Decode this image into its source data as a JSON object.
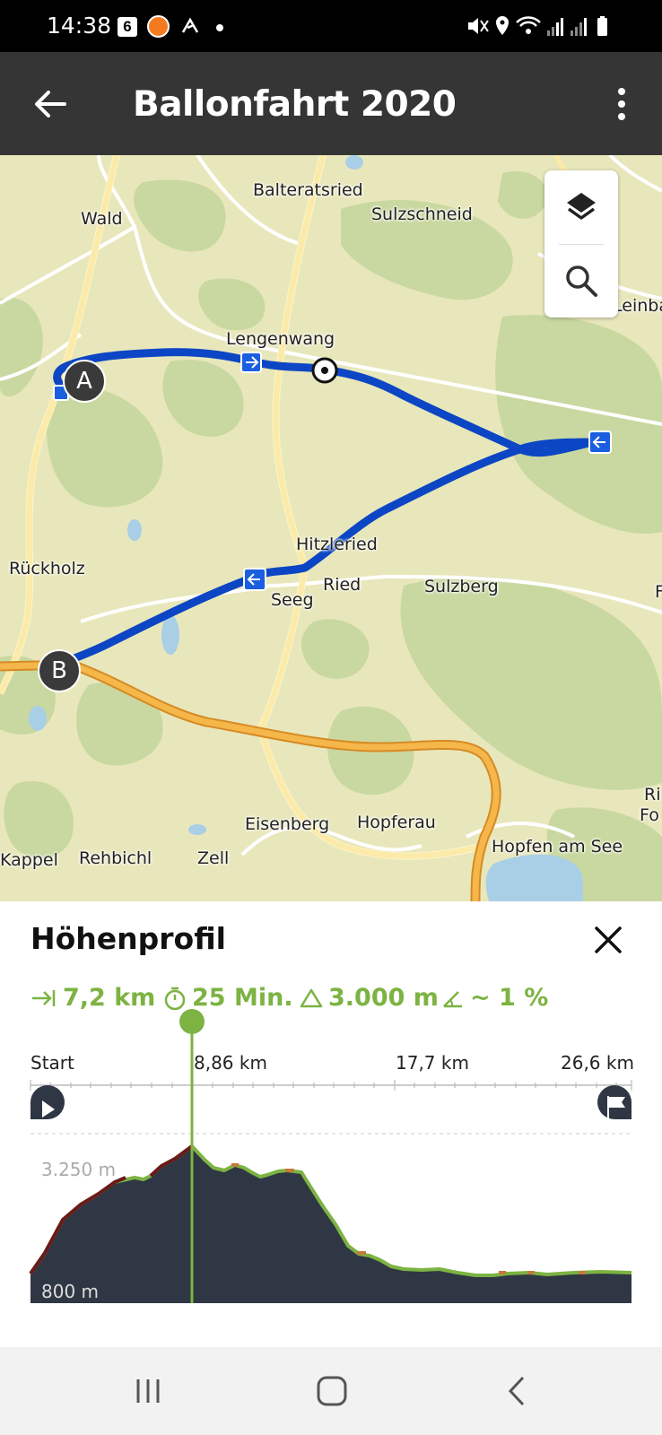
{
  "status_bar": {
    "time": "14:38",
    "badge": "6",
    "icons": [
      "mute-icon",
      "location-icon",
      "wifi-icon",
      "signal-icon",
      "signal-icon",
      "battery-icon"
    ]
  },
  "app_bar": {
    "title": "Ballonfahrt 2020",
    "back_icon": "arrow-left-icon",
    "menu_icon": "more-vert-icon"
  },
  "map": {
    "places": [
      "Balteratsried",
      "Wald",
      "Sulzschneid",
      "Leinba",
      "Lengenwang",
      "Hitzleried",
      "Rückholz",
      "Ried",
      "Seeg",
      "Sulzberg",
      "Ri",
      "Fo",
      "Eisenberg",
      "Hopferau",
      "Hopfen am See",
      "Kappel",
      "Rehbichl",
      "Zell",
      "F"
    ],
    "markers": {
      "start": "A",
      "end": "B"
    },
    "tools": {
      "layers_icon": "layers-icon",
      "search_icon": "search-icon"
    },
    "colors": {
      "route": "#0c46c4",
      "land": "#e8e7bb",
      "forest": "#c9d8a0",
      "highway": "#f5b64a",
      "road": "#fbeaa8",
      "water": "#a9cfe6"
    }
  },
  "profile_panel": {
    "title": "Höhenprofil",
    "close_icon": "close-icon",
    "stats": {
      "distance": "7,2 km",
      "duration": "25 Min.",
      "elevation": "3.000 m",
      "gradient": "~ 1 %"
    },
    "axis_ticks": [
      "Start",
      "8,86 km",
      "17,7 km",
      "26,6 km"
    ],
    "y_labels": [
      "3.250 m",
      "800 m"
    ],
    "start_icon": "play-icon",
    "finish_icon": "finish-flag-icon",
    "accent_color": "#7cb342",
    "fill_color": "#2f3744"
  },
  "nav_bar": {
    "icons": [
      "recent-apps-icon",
      "home-icon",
      "back-icon"
    ]
  }
}
